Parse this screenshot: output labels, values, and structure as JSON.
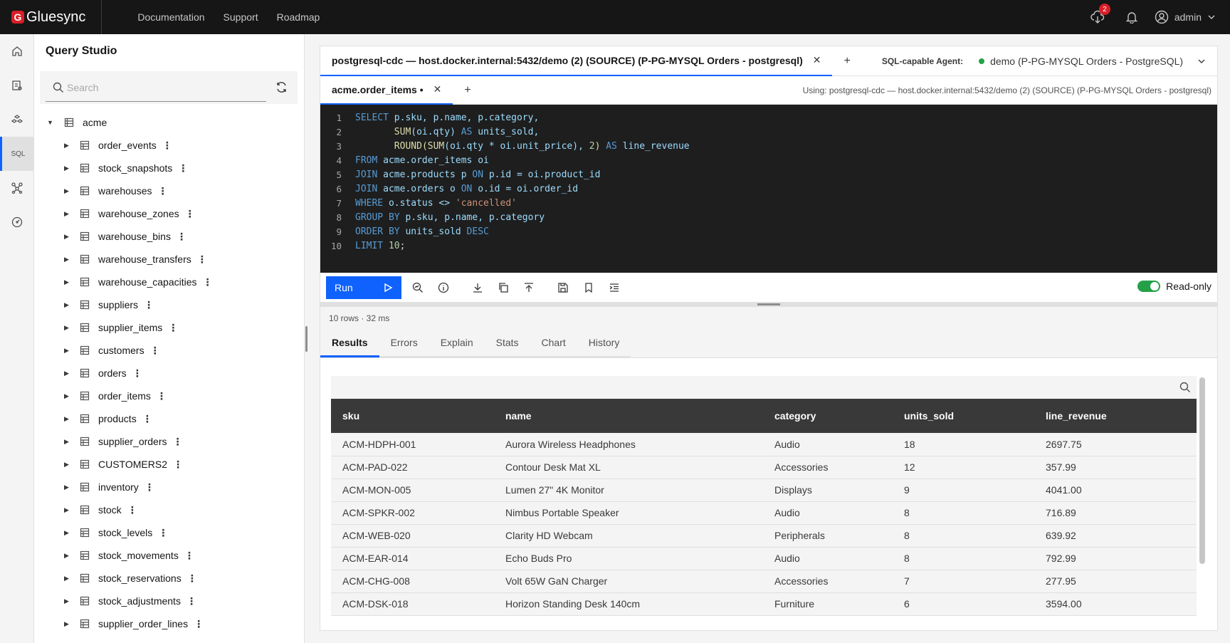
{
  "brand": {
    "logo_letter": "G",
    "name": "Gluesync"
  },
  "nav": {
    "documentation": "Documentation",
    "support": "Support",
    "roadmap": "Roadmap"
  },
  "header": {
    "notification_count": "2",
    "user": "admin"
  },
  "sidepanel": {
    "title": "Query Studio",
    "search_placeholder": "Search",
    "root": "acme",
    "tables": [
      "order_events",
      "stock_snapshots",
      "warehouses",
      "warehouse_zones",
      "warehouse_bins",
      "warehouse_transfers",
      "warehouse_capacities",
      "suppliers",
      "supplier_items",
      "customers",
      "orders",
      "order_items",
      "products",
      "supplier_orders",
      "CUSTOMERS2",
      "inventory",
      "stock",
      "stock_levels",
      "stock_movements",
      "stock_reservations",
      "stock_adjustments",
      "supplier_order_lines"
    ]
  },
  "connection_tab": {
    "label": "postgresql-cdc — host.docker.internal:5432/demo (2) (SOURCE) (P-PG-MYSQL Orders - postgresql)"
  },
  "agent": {
    "label": "SQL-capable Agent:",
    "value": "demo (P-PG-MYSQL Orders - PostgreSQL)",
    "status_color": "#24a148"
  },
  "file_tab": {
    "label": "acme.order_items •",
    "using": "Using: postgresql-cdc — host.docker.internal:5432/demo (2) (SOURCE) (P-PG-MYSQL Orders - postgresql)"
  },
  "editor": {
    "line_numbers": [
      "1",
      "2",
      "3",
      "4",
      "5",
      "6",
      "7",
      "8",
      "9",
      "10"
    ],
    "tokens": [
      "SELECT",
      " p.sku, p.name, p.category,",
      "SUM",
      "(oi.qty)",
      "AS",
      "units_sold,",
      "ROUND",
      "(",
      "SUM",
      "(oi.qty * oi.unit_price), ",
      "2",
      ")",
      "AS",
      "line_revenue",
      "FROM",
      " acme.order_items oi",
      "JOIN",
      " acme.products p ",
      "ON",
      " p.id = oi.product_id",
      "JOIN",
      " acme.orders o ",
      "ON",
      " o.id = oi.order_id",
      "WHERE",
      " o.status <> ",
      "'cancelled'",
      "GROUP BY",
      " p.sku, p.name, p.category",
      "ORDER BY",
      " units_sold ",
      "DESC",
      "LIMIT",
      " ",
      "10",
      ";"
    ]
  },
  "toolbar": {
    "run_label": "Run",
    "readonly_label": "Read-only",
    "readonly_on": true
  },
  "results": {
    "meta": "10 rows · 32 ms",
    "tabs": [
      "Results",
      "Errors",
      "Explain",
      "Stats",
      "Chart",
      "History"
    ],
    "columns": [
      "sku",
      "name",
      "category",
      "units_sold",
      "line_revenue"
    ],
    "rows": [
      [
        "ACM-HDPH-001",
        "Aurora Wireless Headphones",
        "Audio",
        "18",
        "2697.75"
      ],
      [
        "ACM-PAD-022",
        "Contour Desk Mat XL",
        "Accessories",
        "12",
        "357.99"
      ],
      [
        "ACM-MON-005",
        "Lumen 27\" 4K Monitor",
        "Displays",
        "9",
        "4041.00"
      ],
      [
        "ACM-SPKR-002",
        "Nimbus Portable Speaker",
        "Audio",
        "8",
        "716.89"
      ],
      [
        "ACM-WEB-020",
        "Clarity HD Webcam",
        "Peripherals",
        "8",
        "639.92"
      ],
      [
        "ACM-EAR-014",
        "Echo Buds Pro",
        "Audio",
        "8",
        "792.99"
      ],
      [
        "ACM-CHG-008",
        "Volt 65W GaN Charger",
        "Accessories",
        "7",
        "277.95"
      ],
      [
        "ACM-DSK-018",
        "Horizon Standing Desk 140cm",
        "Furniture",
        "6",
        "3594.00"
      ]
    ]
  },
  "colors": {
    "accent": "#0f62fe",
    "brand": "#da1e28",
    "success": "#24a148"
  }
}
